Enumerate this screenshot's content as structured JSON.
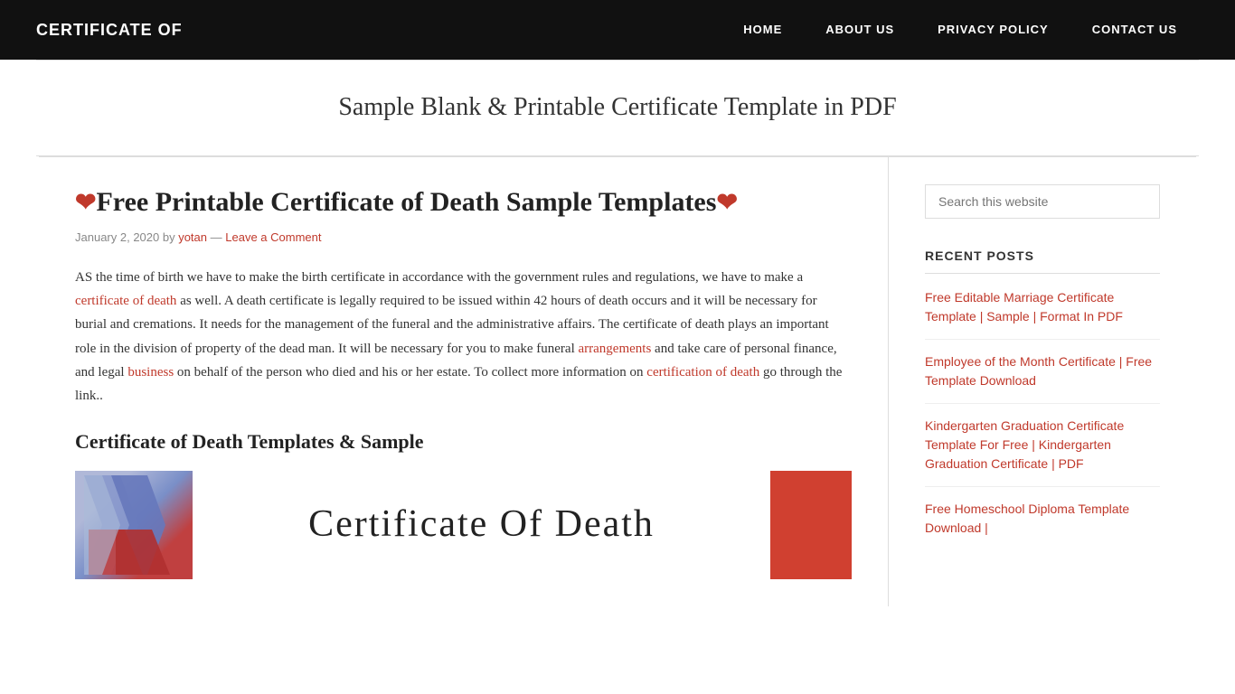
{
  "header": {
    "site_title": "CERTIFICATE OF",
    "nav": [
      {
        "label": "HOME",
        "id": "home"
      },
      {
        "label": "ABOUT US",
        "id": "about"
      },
      {
        "label": "PRIVACY POLICY",
        "id": "privacy"
      },
      {
        "label": "CONTACT US",
        "id": "contact"
      }
    ]
  },
  "page": {
    "subtitle": "Sample Blank & Printable Certificate Template in PDF"
  },
  "article": {
    "title_prefix": "❤",
    "title_text": "Free Printable Certificate of Death Sample Templates",
    "title_suffix": "❤",
    "meta_date": "January 2, 2020",
    "meta_by": "by",
    "meta_author": "yotan",
    "meta_separator": "—",
    "meta_comment_link": "Leave a Comment",
    "body_p1": "AS the time of birth we have to make the birth certificate in accordance with the government rules and regulations, we have to make a",
    "body_p1_link": "certificate of death",
    "body_p1_rest": "as well. A death certificate is legally required to be issued within 42 hours of death occurs and it will be necessary for burial and cremations. It needs for the management of the funeral and the administrative affairs. The certificate of death plays an important role in the division of property of the dead man. It will be necessary for you to make funeral",
    "body_p1_link2": "arrangements",
    "body_p1_rest2": "and take care of personal finance, and legal",
    "body_p1_link3": "business",
    "body_p1_rest3": "on behalf of the person who died and his or her estate. To collect more information on",
    "body_p1_link4": "certification of death",
    "body_p1_end": "go through the link..",
    "section_heading": "Certificate of Death Templates & Sample",
    "cert_center_text": "Certificate Of Death"
  },
  "sidebar": {
    "search_placeholder": "Search this website",
    "recent_posts_heading": "RECENT POSTS",
    "recent_posts": [
      {
        "label": "Free Editable Marriage Certificate Template | Sample | Format In PDF",
        "id": "post-1"
      },
      {
        "label": "Employee of the Month Certificate | Free Template Download",
        "id": "post-2"
      },
      {
        "label": "Kindergarten Graduation Certificate Template For Free | Kindergarten Graduation Certificate | PDF",
        "id": "post-3"
      },
      {
        "label": "Free Homeschool Diploma Template Download |",
        "id": "post-4"
      }
    ]
  }
}
